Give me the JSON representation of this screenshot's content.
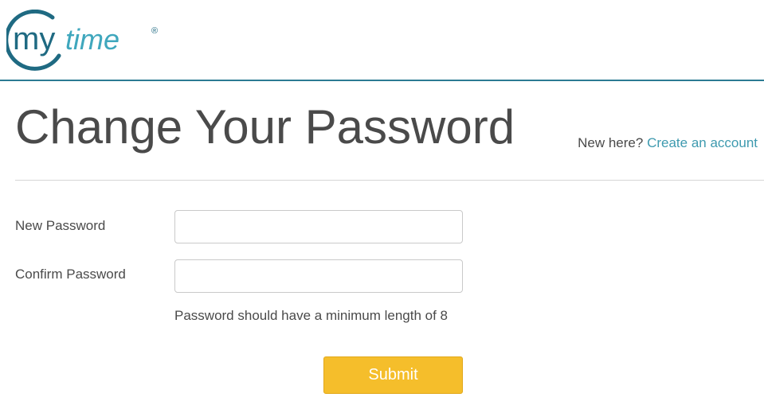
{
  "brand": {
    "logo_my": "my",
    "logo_time": "time",
    "logo_mark": "®",
    "colors": {
      "dark": "#1f6a82",
      "light": "#3fa7bd",
      "accent_line": "#2b7a93"
    }
  },
  "page": {
    "title": "Change Your Password",
    "signup_prompt": "New here?",
    "signup_link": "Create an account"
  },
  "form": {
    "new_password_label": "New Password",
    "new_password_value": "",
    "confirm_password_label": "Confirm Password",
    "confirm_password_value": "",
    "hint": "Password should have a minimum length of 8",
    "submit_label": "Submit",
    "submit_color": "#f5be2b"
  }
}
